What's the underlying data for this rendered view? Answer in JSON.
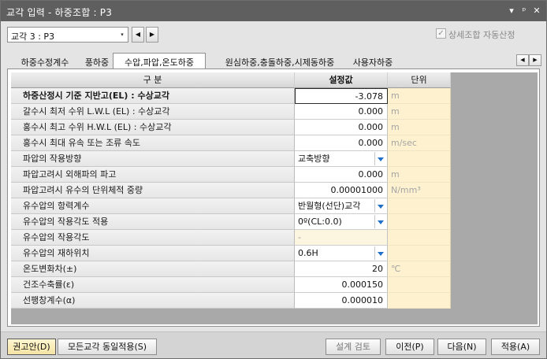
{
  "window": {
    "title": "교각 입력 - 하중조합 : P3",
    "buttons": {
      "menu": "▾",
      "pin": "ᵖ",
      "close": "✕"
    }
  },
  "topbar": {
    "pier_select": "교각 3 : P3",
    "pier_select_arrow": "▾",
    "prev": "◀",
    "next": "▶",
    "auto_calc_checked": "✓",
    "auto_calc_label": "상세조합 자동산정"
  },
  "tabs": [
    {
      "label": "하중수정계수"
    },
    {
      "label": "풍하중"
    },
    {
      "label": "수압,파압,온도하중"
    },
    {
      "label": "원심하중,충돌하중,시제동하중"
    },
    {
      "label": "사용자하중"
    }
  ],
  "tab_scroll": {
    "left": "◀",
    "right": "▶"
  },
  "grid": {
    "headers": {
      "category": "구 분",
      "value": "설정값",
      "unit": "단위"
    },
    "rows": [
      {
        "label": "하중산정시 기준 지반고(EL) : 수상교각",
        "value": "-3.078",
        "unit": "m"
      },
      {
        "label": "갈수시 최저 수위 L.W.L (EL) : 수상교각",
        "value": "0.000",
        "unit": "m"
      },
      {
        "label": "홍수시 최고 수위 H.W.L (EL) : 수상교각",
        "value": "0.000",
        "unit": "m"
      },
      {
        "label": "홍수시 최대 유속 또는 조류 속도",
        "value": "0.000",
        "unit": "m/sec"
      },
      {
        "label": "파압의 작용방향",
        "value": "교축방향",
        "unit": ""
      },
      {
        "label": "파압고려시 외해파의 파고",
        "value": "0.000",
        "unit": "m"
      },
      {
        "label": "파압고려시 유수의 단위체적 중량",
        "value": "0.00001000",
        "unit": "N/mm³"
      },
      {
        "label": "유수압의 항력계수",
        "value": "반월형(선단)교각",
        "unit": ""
      },
      {
        "label": "유수압의 작용각도 적용",
        "value": "0º(CL:0.0)",
        "unit": ""
      },
      {
        "label": "유수압의 작용각도",
        "value": "-",
        "unit": ""
      },
      {
        "label": "유수압의 재하위치",
        "value": "0.6H",
        "unit": ""
      },
      {
        "label": "온도변화차(±)",
        "value": "20",
        "unit": "℃"
      },
      {
        "label": "건조수축률(ε)",
        "value": "0.000150",
        "unit": ""
      },
      {
        "label": "선팽창계수(α)",
        "value": "0.000010",
        "unit": ""
      }
    ]
  },
  "bottom": {
    "recommend": "권고안(D)",
    "apply_all": "모든교각 동일적용(S)",
    "design_check": "설계 검토",
    "prev": "이전(P)",
    "next": "다음(N)",
    "apply": "적용(A)"
  }
}
